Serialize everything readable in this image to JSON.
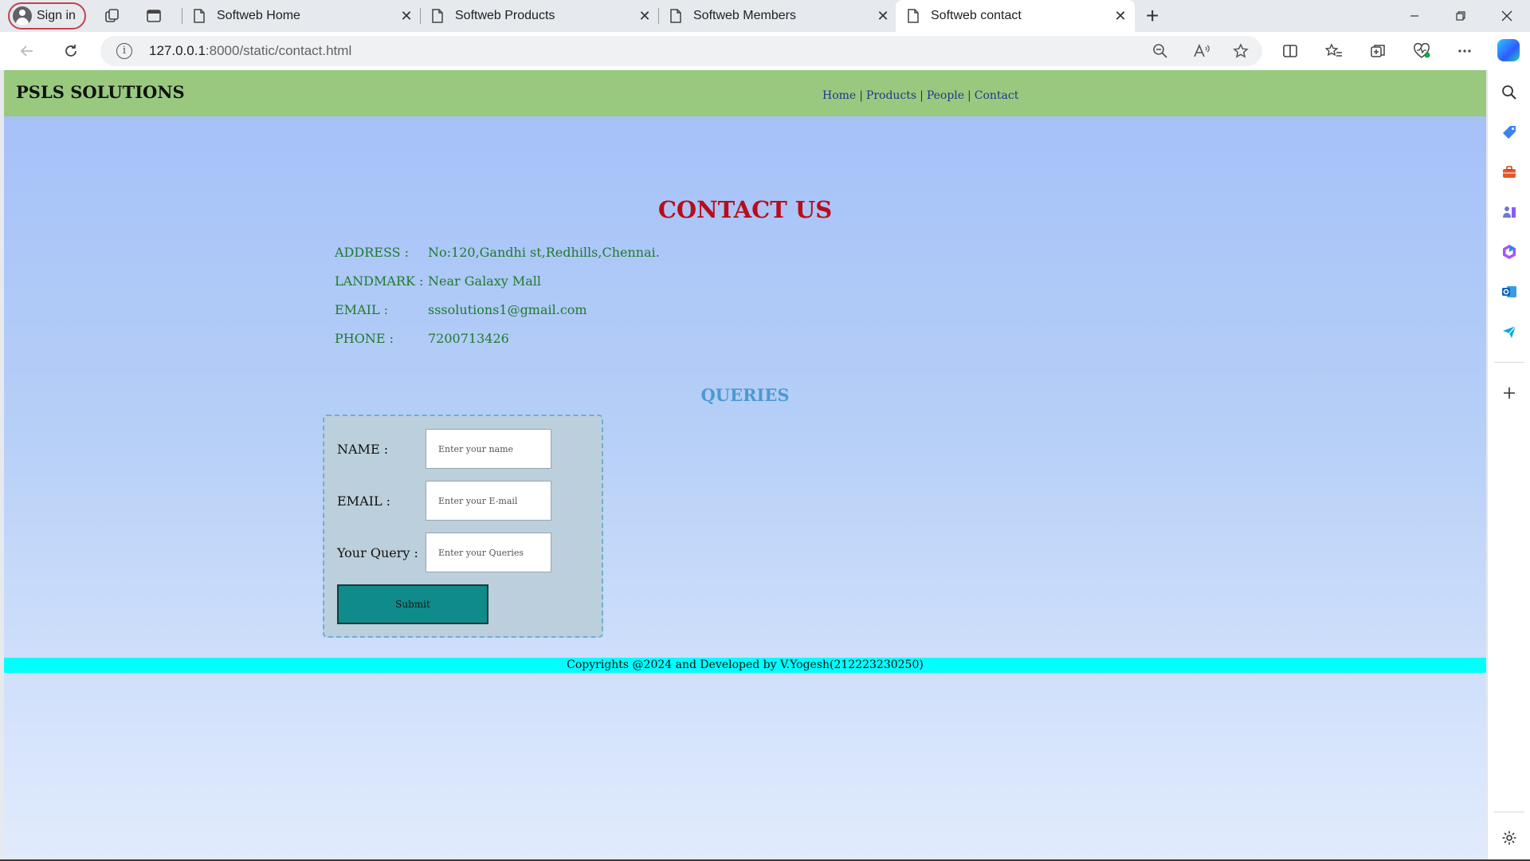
{
  "browser": {
    "sign_in_label": "Sign in",
    "tabs": [
      {
        "title": "Softweb Home",
        "active": false
      },
      {
        "title": "Softweb Products",
        "active": false
      },
      {
        "title": "Softweb Members",
        "active": false
      },
      {
        "title": "Softweb contact",
        "active": true
      }
    ],
    "url": {
      "host": "127.0.0.1",
      "path": ":8000/static/contact.html"
    }
  },
  "site": {
    "brand": "PSLS SOLUTIONS",
    "nav": [
      {
        "label": "Home"
      },
      {
        "label": "Products"
      },
      {
        "label": "People"
      },
      {
        "label": "Contact"
      }
    ],
    "nav_separator": "|"
  },
  "contact": {
    "title": "CONTACT US",
    "rows": [
      {
        "label": "ADDRESS :",
        "value": "No:120,Gandhi st,Redhills,Chennai."
      },
      {
        "label": "LANDMARK :",
        "value": "Near Galaxy Mall"
      },
      {
        "label": "EMAIL :",
        "value": "sssolutions1@gmail.com"
      },
      {
        "label": "PHONE :",
        "value": "7200713426"
      }
    ]
  },
  "queries": {
    "title": "QUERIES",
    "fields": [
      {
        "label": "NAME :",
        "placeholder": "Enter your name"
      },
      {
        "label": "EMAIL :",
        "placeholder": "Enter your E-mail"
      },
      {
        "label": "Your Query :",
        "placeholder": "Enter your Queries"
      }
    ],
    "submit_label": "Submit"
  },
  "footer": {
    "text": "Copyrights @2024 and Developed by V.Yogesh(212223230250)"
  },
  "colors": {
    "header_bg": "#99c97f",
    "contact_title": "#b80d1b",
    "info_text": "#1e7a2e",
    "queries_title": "#4a9ad3",
    "submit_bg": "#0f8b8b",
    "footer_bg": "#00ffff"
  }
}
